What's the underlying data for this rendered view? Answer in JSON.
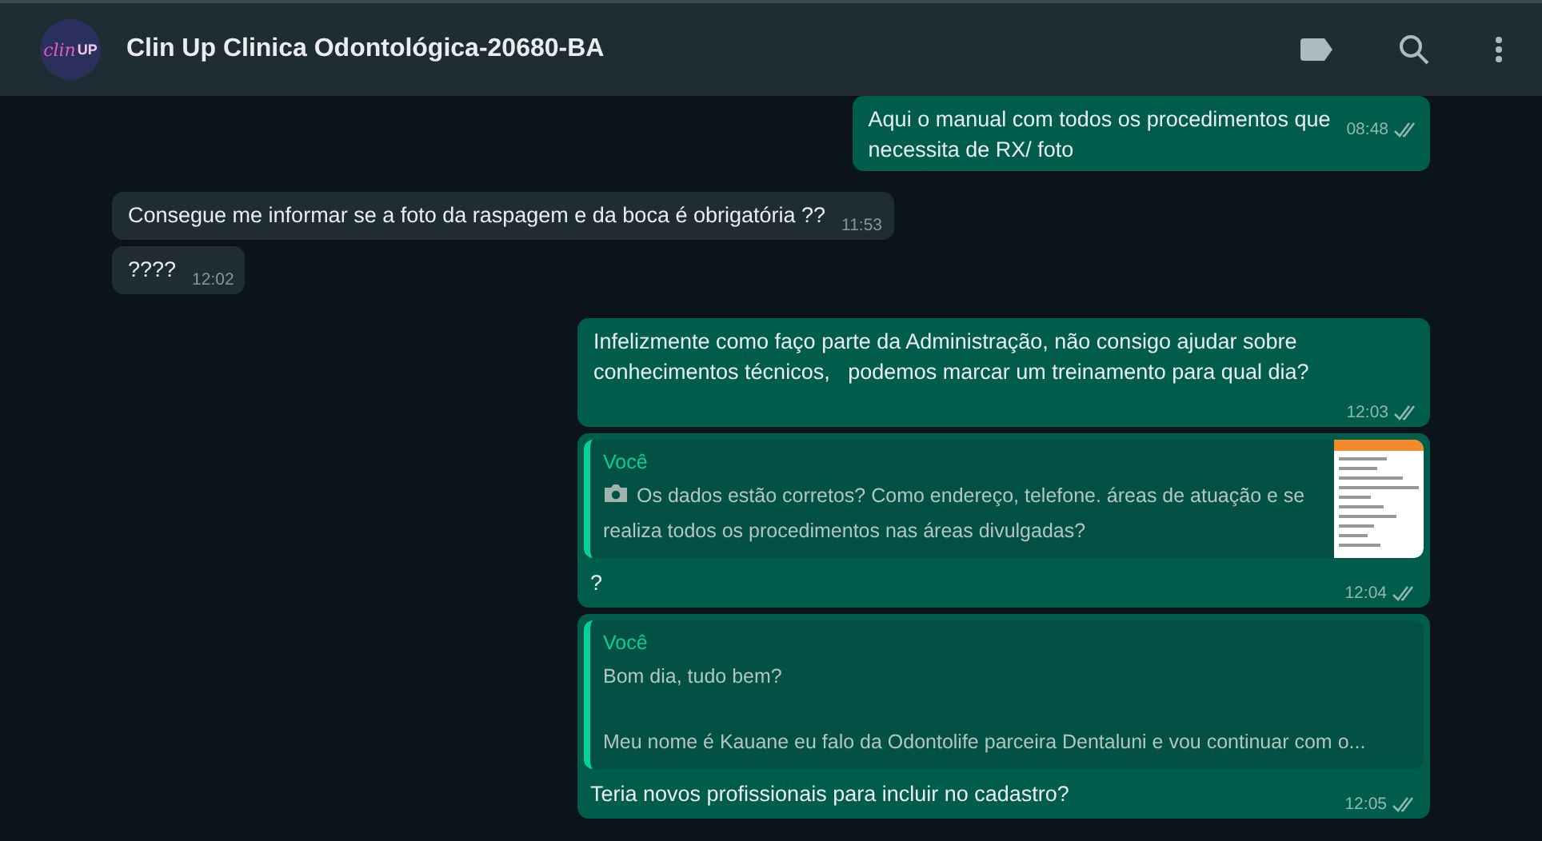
{
  "header": {
    "avatar": {
      "text": "clin",
      "text2": "UP"
    },
    "title": "Clin Up Clinica Odontológica-20680-BA"
  },
  "messages": [
    {
      "kind": "text",
      "outgoing": true,
      "text": "Aqui o manual com todos os procedimentos que\nnecessita de RX/ foto",
      "time": "08:48",
      "read": false
    },
    {
      "kind": "text",
      "outgoing": false,
      "text": "Consegue me informar se a foto da raspagem e da boca é obrigatória ??",
      "time": "11:53"
    },
    {
      "kind": "text",
      "outgoing": false,
      "text": "????",
      "time": "12:02"
    },
    {
      "kind": "text",
      "outgoing": true,
      "text": "Infelizmente como faço parte da Administração, não consigo ajudar sobre conhecimentos técnicos,   podemos marcar um treinamento para qual dia?",
      "time": "12:03",
      "read": false
    },
    {
      "kind": "reply",
      "outgoing": true,
      "quote": {
        "author": "Você",
        "photo": true,
        "lines": [
          "Os dados estão corretos? Como endereço, telefone. áreas de atuação e se realiza todos os procedimentos nas áreas divulgadas?"
        ]
      },
      "text": "?",
      "time": "12:04",
      "read": false
    },
    {
      "kind": "reply",
      "outgoing": true,
      "quote": {
        "author": "Você",
        "photo": false,
        "lines": [
          "Bom dia, tudo bem?",
          "Meu nome é Kauane eu falo da Odontolife parceira Dentaluni e vou continuar com o..."
        ]
      },
      "text": "Teria novos profissionais para incluir no cadastro?",
      "time": "12:05",
      "read": false
    }
  ]
}
